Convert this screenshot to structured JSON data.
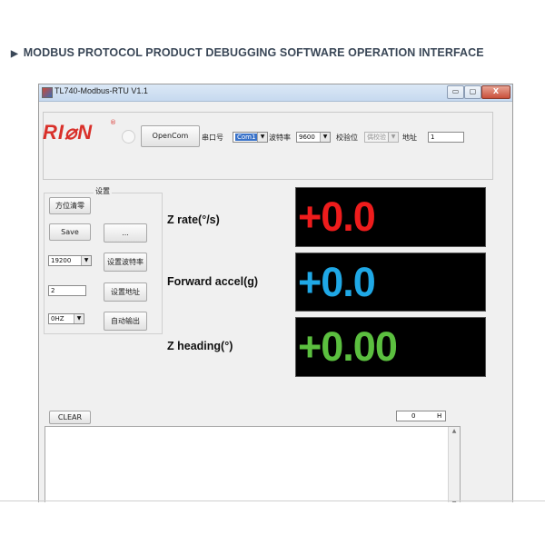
{
  "heading": {
    "marker": "▶",
    "text": "MODBUS PROTOCOL PRODUCT DEBUGGING SOFTWARE OPERATION INTERFACE"
  },
  "window": {
    "title": "TL740-Modbus-RTU V1.1",
    "controls": {
      "minimize": "▭",
      "maximize": "▢",
      "close": "X"
    }
  },
  "connection": {
    "logo_text": "RI⌀N",
    "logo_reg": "®",
    "open_button": "OpenCom",
    "port_label": "串口号",
    "port_value": "Com1",
    "baud_label": "波特率",
    "baud_value": "9600",
    "parity_label": "校验位",
    "parity_value": "偶校验",
    "address_label": "地址",
    "address_value": "1"
  },
  "settings": {
    "group_title": "设置",
    "azimuth_zero_button": "方位清零",
    "save_button": "Save",
    "more_button": "...",
    "baud_select": "19200",
    "set_baud_button": "设置波特率",
    "address_input": "2",
    "set_address_button": "设置地址",
    "rate_select": "0HZ",
    "auto_output_button": "自动输出"
  },
  "measurements": [
    {
      "label": "Z rate(°/s)",
      "value": "+0.0",
      "color": "#ee1c1c"
    },
    {
      "label": "Forward accel(g)",
      "value": "+0.0",
      "color": "#1fa8e6"
    },
    {
      "label": "Z heading(°)",
      "value": "+0.00",
      "color": "#5bbf3f"
    }
  ],
  "log": {
    "clear_button": "CLEAR",
    "counter_value": "0",
    "counter_unit": "H",
    "scroll_up": "▲",
    "scroll_down": "▼"
  }
}
